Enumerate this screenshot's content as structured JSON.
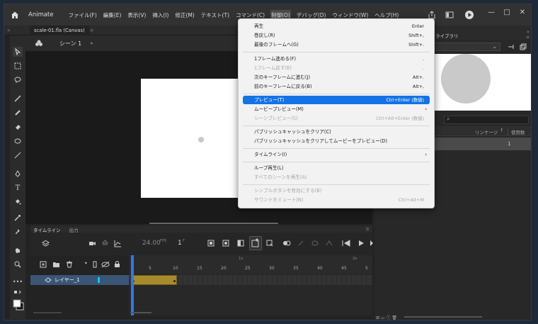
{
  "app": {
    "name": "Animate"
  },
  "menubar": {
    "items": [
      "ファイル(F)",
      "編集(E)",
      "表示(V)",
      "挿入(I)",
      "修正(M)",
      "テキスト(T)",
      "コマンド(C)",
      "制御(O)",
      "デバッグ(D)",
      "ウィンドウ(W)",
      "ヘルプ(H)"
    ]
  },
  "document": {
    "tab_title": "scale-01.fla (Canvas)",
    "close": "×"
  },
  "scene": {
    "label": "シーン 1"
  },
  "timeline": {
    "tab_timeline": "タイムライン",
    "tab_output": "出力",
    "fps": "24.00",
    "fps_unit": "FPS",
    "current_frame": "1",
    "frame_unit": "F",
    "ruler_top": [
      "1s",
      "2s"
    ],
    "ruler": [
      "1",
      "5",
      "10",
      "15",
      "20",
      "25",
      "30",
      "35",
      "40",
      "45",
      "5"
    ],
    "layer_name": "レイヤー_1"
  },
  "rightpanel": {
    "tab_library": "ライブラリ",
    "col_linkage": "リンケージ",
    "col_usage": "使用数",
    "usage_value": "1"
  },
  "control_menu": {
    "items": [
      {
        "label": "再生",
        "shortcut": "Enter",
        "disabled": false
      },
      {
        "label": "巻戻し(R)",
        "shortcut": "Shift+,",
        "disabled": false
      },
      {
        "label": "最後のフレームへ(G)",
        "shortcut": "Shift+.",
        "disabled": false
      },
      {
        "label": "1フレーム進める(F)",
        "shortcut": ".",
        "disabled": false
      },
      {
        "label": "1フレーム戻す(E)",
        "shortcut": ",",
        "disabled": true
      },
      {
        "label": "次のキーフレームに進む(J)",
        "shortcut": "Alt+.",
        "disabled": false
      },
      {
        "label": "前のキーフレームに戻る(B)",
        "shortcut": "Alt+,",
        "disabled": false
      },
      {
        "label": "プレビュー(T)",
        "shortcut": "Ctrl+Enter (数値)",
        "disabled": false,
        "highlight": true
      },
      {
        "label": "ムービープレビュー(M)",
        "shortcut": "",
        "disabled": false,
        "submenu": true
      },
      {
        "label": "シーンプレビュー(S)",
        "shortcut": "Ctrl+Alt+Enter (数値)",
        "disabled": true
      },
      {
        "label": "パブリッシュキャッシュをクリア(C)",
        "shortcut": "",
        "disabled": false
      },
      {
        "label": "パブリッシュキャッシュをクリアしてムービーをプレビュー(D)",
        "shortcut": "",
        "disabled": false
      },
      {
        "label": "タイムライン(I)",
        "shortcut": "",
        "disabled": false,
        "submenu": true
      },
      {
        "label": "ループ再生(L)",
        "shortcut": "",
        "disabled": false
      },
      {
        "label": "すべてのシーンを再生(A)",
        "shortcut": "",
        "disabled": true
      },
      {
        "label": "シンプルボタンを有効にする(B)",
        "shortcut": "",
        "disabled": true
      },
      {
        "label": "サウンドをミュート(N)",
        "shortcut": "Ctrl+Alt+M",
        "disabled": true
      }
    ]
  },
  "colors": {
    "accent": "#1473e6",
    "frame_span": "#a88a2e",
    "layer_color": "#00c8ff"
  }
}
